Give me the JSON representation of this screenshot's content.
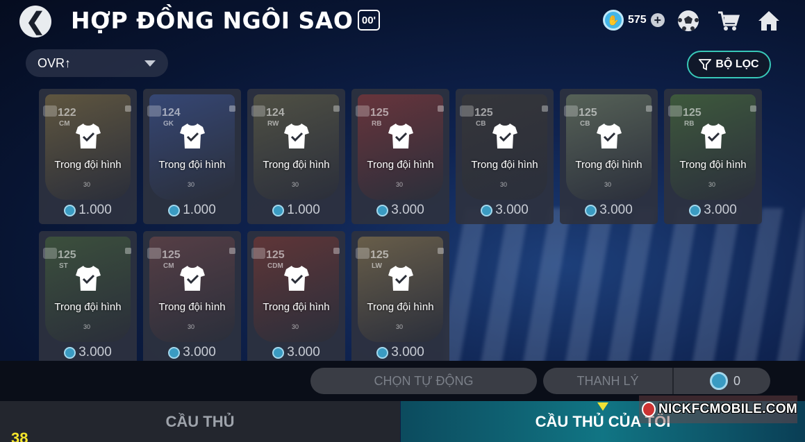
{
  "header": {
    "title": "HỢP ĐỒNG NGÔI SAO",
    "badge": "00'",
    "coins": "575"
  },
  "controls": {
    "sort_label": "OVR↑",
    "filter_label": "BỘ LỌC"
  },
  "cards": [
    {
      "ovr": "122",
      "pos": "CM",
      "level": "30",
      "status": "Trong đội hình",
      "price": "1.000",
      "art": "#8a7540"
    },
    {
      "ovr": "124",
      "pos": "GK",
      "level": "30",
      "status": "Trong đội hình",
      "price": "1.000",
      "art": "#3f5aa0"
    },
    {
      "ovr": "124",
      "pos": "RW",
      "level": "30",
      "status": "Trong đội hình",
      "price": "1.000",
      "art": "#6e6a48"
    },
    {
      "ovr": "125",
      "pos": "RB",
      "level": "30",
      "status": "Trong đội hình",
      "price": "3.000",
      "art": "#9a3838"
    },
    {
      "ovr": "125",
      "pos": "CB",
      "level": "30",
      "status": "Trong đội hình",
      "price": "3.000",
      "art": "#3d3a34"
    },
    {
      "ovr": "125",
      "pos": "CB",
      "level": "30",
      "status": "Trong đội hình",
      "price": "3.000",
      "art": "#7a8a6a"
    },
    {
      "ovr": "125",
      "pos": "RB",
      "level": "30",
      "status": "Trong đội hình",
      "price": "3.000",
      "art": "#4e7a3a"
    },
    {
      "ovr": "125",
      "pos": "ST",
      "level": "30",
      "status": "Trong đội hình",
      "price": "3.000",
      "art": "#4a6a3a"
    },
    {
      "ovr": "125",
      "pos": "CM",
      "level": "30",
      "status": "Trong đội hình",
      "price": "3.000",
      "art": "#7a4a4a"
    },
    {
      "ovr": "125",
      "pos": "CDM",
      "level": "30",
      "status": "Trong đội hình",
      "price": "3.000",
      "art": "#8a3a30"
    },
    {
      "ovr": "125",
      "pos": "LW",
      "level": "30",
      "status": "Trong đội hình",
      "price": "3.000",
      "art": "#9a8250"
    }
  ],
  "actions": {
    "auto_select": "CHỌN TỰ ĐỘNG",
    "sell": "THANH LÝ",
    "sell_count": "0"
  },
  "tabs": {
    "players": "CẦU THỦ",
    "my_players": "CẦU THỦ CỦA TÔI"
  },
  "watermark": "NICKFCMOBILE.COM",
  "corner_number": "38",
  "colors": {
    "accent_teal": "#38c8b8",
    "coin_blue": "#43b6e8",
    "tab_marker": "#f0e337"
  }
}
